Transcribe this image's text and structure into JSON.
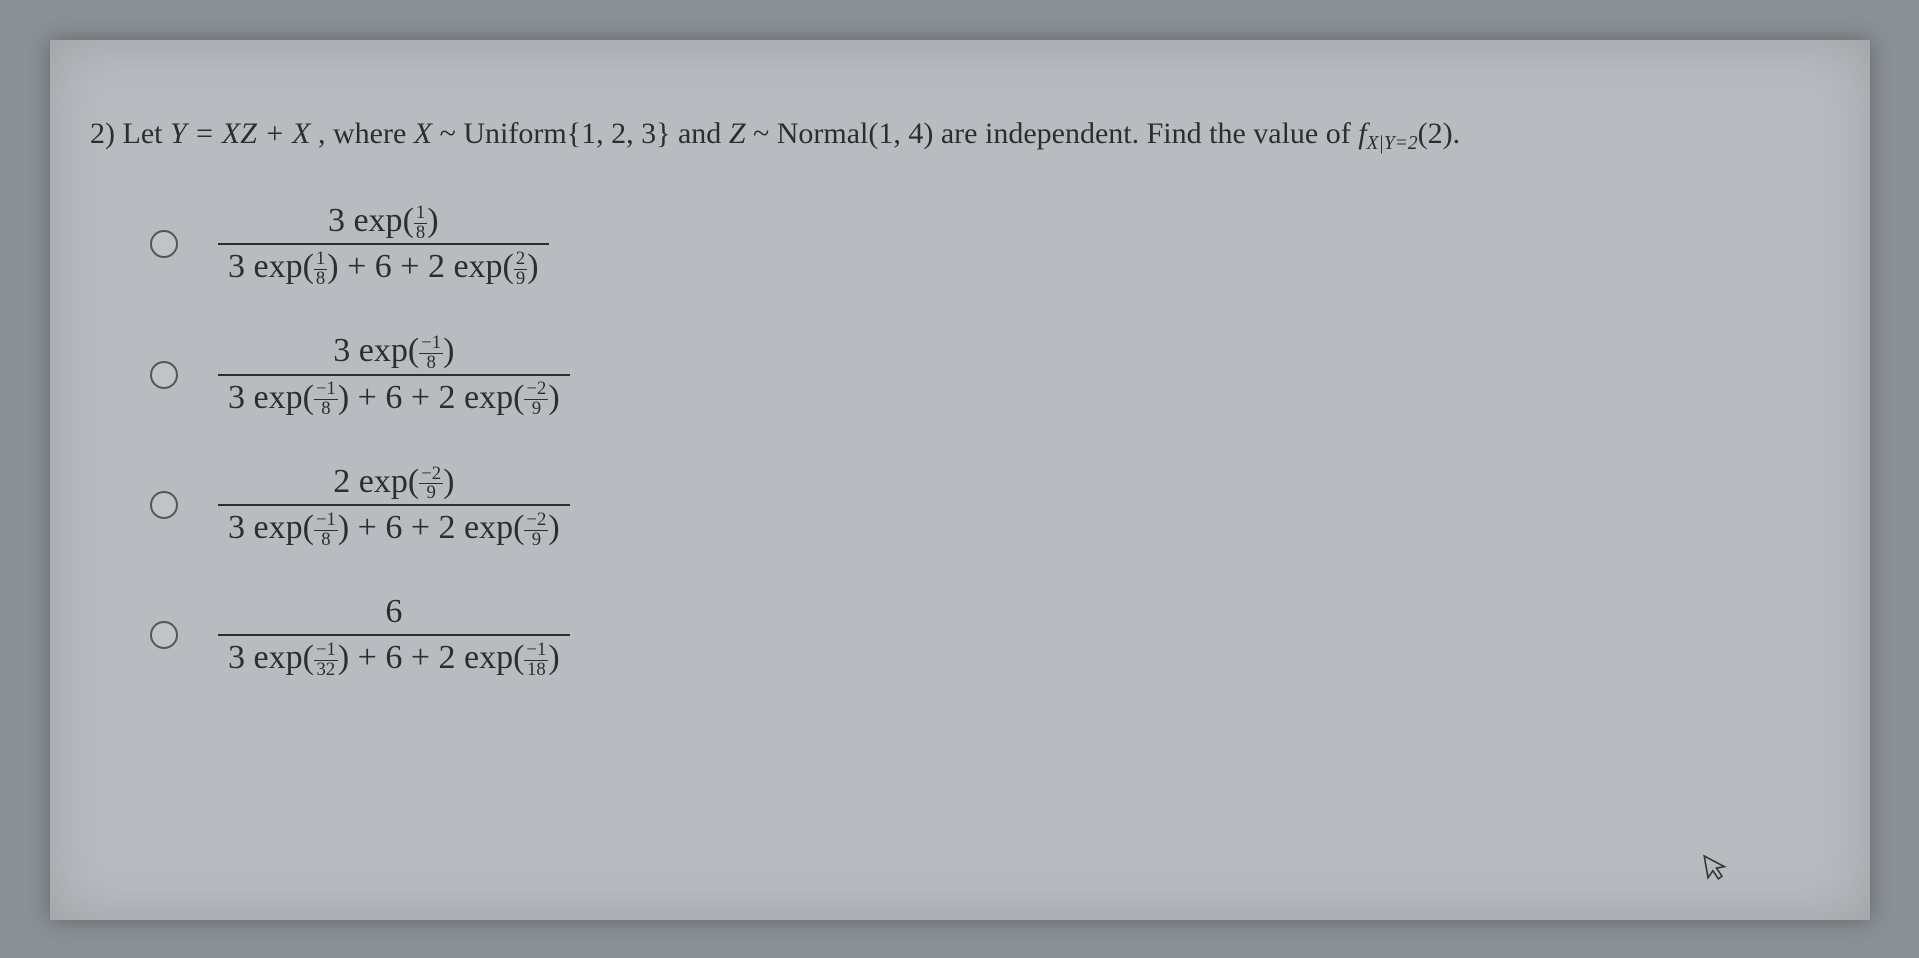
{
  "question": {
    "number": "2)",
    "prefix": "Let ",
    "expr_y": "Y = XZ + X",
    "where": ", where ",
    "dist_x_var": "X",
    "dist_x_sym": " ~ ",
    "dist_x": "Uniform{1, 2, 3}",
    "and": " and ",
    "dist_z_var": "Z",
    "dist_z_sym": " ~ ",
    "dist_z": "Normal(1, 4)",
    "indep": " are independent. Find the value of ",
    "target_f": "f",
    "target_sub": "X|Y=2",
    "target_arg": "(2)",
    "period": "."
  },
  "options": [
    {
      "num_coef": "3 exp",
      "num_frac_n": "1",
      "num_frac_d": "8",
      "den_t1_coef": "3 exp",
      "den_t1_frac_n": "1",
      "den_t1_frac_d": "8",
      "den_mid": " + 6 + ",
      "den_t2_coef": "2 exp",
      "den_t2_frac_n": "2",
      "den_t2_frac_d": "9"
    },
    {
      "num_coef": "3 exp",
      "num_frac_n": "−1",
      "num_frac_d": "8",
      "den_t1_coef": "3 exp",
      "den_t1_frac_n": "−1",
      "den_t1_frac_d": "8",
      "den_mid": " + 6 + ",
      "den_t2_coef": "2 exp",
      "den_t2_frac_n": "−2",
      "den_t2_frac_d": "9"
    },
    {
      "num_coef": "2 exp",
      "num_frac_n": "−2",
      "num_frac_d": "9",
      "den_t1_coef": "3 exp",
      "den_t1_frac_n": "−1",
      "den_t1_frac_d": "8",
      "den_mid": " + 6 + ",
      "den_t2_coef": "2 exp",
      "den_t2_frac_n": "−2",
      "den_t2_frac_d": "9"
    },
    {
      "num_plain": "6",
      "den_t1_coef": "3 exp",
      "den_t1_frac_n": "−1",
      "den_t1_frac_d": "32",
      "den_mid": " + 6 + ",
      "den_t2_coef": "2 exp",
      "den_t2_frac_n": "−1",
      "den_t2_frac_d": "18"
    }
  ]
}
